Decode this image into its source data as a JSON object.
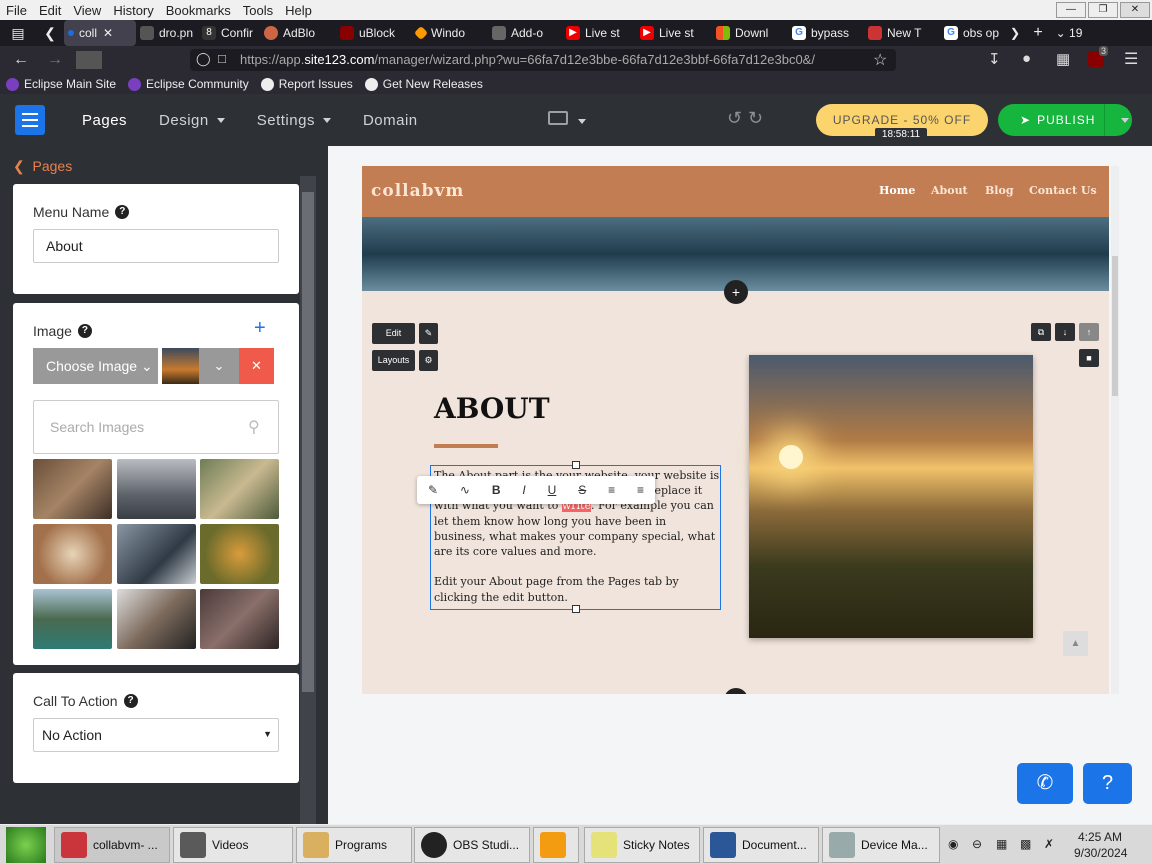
{
  "browser": {
    "menu": [
      "File",
      "Edit",
      "View",
      "History",
      "Bookmarks",
      "Tools",
      "Help"
    ],
    "tabs": [
      {
        "label": "coll",
        "color": "#1c6ee0"
      },
      {
        "label": "dro.pn",
        "color": "#555"
      },
      {
        "label": "Confir",
        "color": "#333"
      },
      {
        "label": "AdBlo",
        "color": "#c64"
      },
      {
        "label": "uBlock",
        "color": "#800"
      },
      {
        "label": "Windo",
        "color": "#f90"
      },
      {
        "label": "Add-o",
        "color": "#666"
      },
      {
        "label": "Live st",
        "color": "#e00"
      },
      {
        "label": "Live st",
        "color": "#e00"
      },
      {
        "label": "Downl",
        "color": "#0a0"
      },
      {
        "label": "bypass",
        "color": "#4285f4"
      },
      {
        "label": "New T",
        "color": "#c33"
      },
      {
        "label": "obs op",
        "color": "#4285f4"
      }
    ],
    "tab_count": "19",
    "url_prefix": "https://app.",
    "url_domain": "site123.com",
    "url_rest": "/manager/wizard.php?wu=66fa7d12e3bbe-66fa7d12e3bbf-66fa7d12e3bc0&/",
    "bookmarks": [
      "Eclipse Main Site",
      "Eclipse Community",
      "Report Issues",
      "Get New Releases"
    ],
    "ext_badge": "3"
  },
  "app": {
    "nav": [
      "Pages",
      "Design",
      "Settings",
      "Domain"
    ],
    "upgrade_label": "UPGRADE - 50% OFF",
    "timer": "18:58:11",
    "publish_label": "PUBLISH",
    "accent": "#16b53d"
  },
  "panel": {
    "back_label": "Pages",
    "menu_name_label": "Menu Name",
    "menu_name_value": "About",
    "image_label": "Image",
    "choose_image": "Choose Image",
    "search_placeholder": "Search Images",
    "cta_label": "Call To Action",
    "cta_value": "No Action"
  },
  "site": {
    "logo": "collabvm",
    "nav": [
      "Home",
      "About",
      "Blog",
      "Contact Us"
    ],
    "edit_btn": "Edit",
    "layouts_btn": "Layouts",
    "heading": "ABOUT",
    "para1_a": "The About part is the ",
    "para1_b": "your website. ",
    "para1_c": "your website is about. You can edit all of this text and replace it with what you want to ",
    "para1_hl": "write",
    "para1_d": ". For example you can let them know how long you have been in business, what makes your company special, what are its core values and more.",
    "para2": "Edit your About page from the Pages tab by clicking the edit button."
  },
  "taskbar": {
    "items": [
      "collabvm- ...",
      "Videos",
      "Programs",
      "OBS Studi...",
      "",
      "Sticky Notes",
      "Document...",
      "Device Ma..."
    ],
    "time": "4:25 AM",
    "date": "9/30/2024"
  }
}
